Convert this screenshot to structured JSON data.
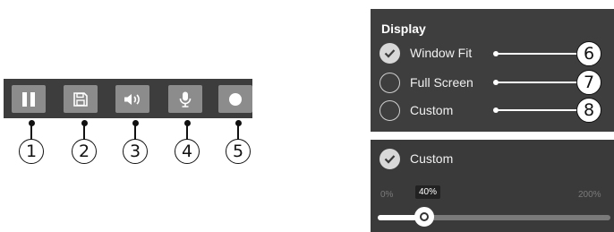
{
  "toolbar": {
    "buttons": [
      {
        "icon": "pause-icon",
        "callout": "1"
      },
      {
        "icon": "save-icon",
        "callout": "2"
      },
      {
        "icon": "speaker-icon",
        "callout": "3"
      },
      {
        "icon": "microphone-icon",
        "callout": "4"
      },
      {
        "icon": "record-icon",
        "callout": "5"
      }
    ]
  },
  "display": {
    "title": "Display",
    "options": [
      {
        "label": "Window Fit",
        "checked": true,
        "callout": "6"
      },
      {
        "label": "Full Screen",
        "checked": false,
        "callout": "7"
      },
      {
        "label": "Custom",
        "checked": false,
        "callout": "8"
      }
    ]
  },
  "custom_zoom": {
    "label": "Custom",
    "checked": true,
    "min_label": "0%",
    "max_label": "200%",
    "value_label": "40%",
    "value_fraction": 0.2
  },
  "colors": {
    "toolbar_bg": "#3d3d3d",
    "button_bg": "#8c8c8c",
    "panel_bg": "#3e3e3e"
  }
}
